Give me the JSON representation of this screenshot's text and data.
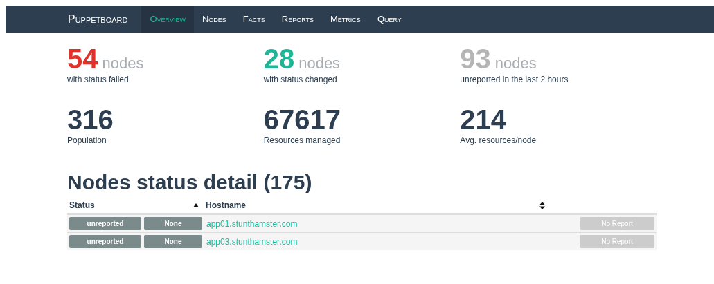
{
  "navbar": {
    "brand": "Puppetboard",
    "items": [
      {
        "label": "Overview",
        "selected": true
      },
      {
        "label": "Nodes",
        "selected": false
      },
      {
        "label": "Facts",
        "selected": false
      },
      {
        "label": "Reports",
        "selected": false
      },
      {
        "label": "Metrics",
        "selected": false
      },
      {
        "label": "Query",
        "selected": false
      }
    ]
  },
  "stats": [
    {
      "value": "54",
      "unit": "nodes",
      "caption": "with status failed",
      "color": "#e0312a"
    },
    {
      "value": "28",
      "unit": "nodes",
      "caption": "with status changed",
      "color": "#1fb596"
    },
    {
      "value": "93",
      "unit": "nodes",
      "caption": "unreported in the last 2 hours",
      "color": "#b5b5b5"
    }
  ],
  "totals": [
    {
      "value": "316",
      "caption": "Population"
    },
    {
      "value": "67617",
      "caption": "Resources managed"
    },
    {
      "value": "214",
      "caption": "Avg. resources/node"
    }
  ],
  "table": {
    "title": "Nodes status detail (175)",
    "columns": [
      {
        "label": "Status",
        "sorted": true
      },
      {
        "label": "Hostname",
        "sorted": false
      }
    ],
    "rows": [
      {
        "status": "unreported",
        "catalog": "None",
        "hostname": "app01.stunthamster.com",
        "report": "No Report"
      },
      {
        "status": "unreported",
        "catalog": "None",
        "hostname": "app03.stunthamster.com",
        "report": "No Report"
      }
    ]
  }
}
